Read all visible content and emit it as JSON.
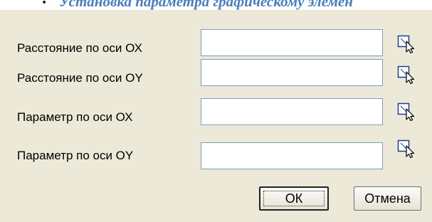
{
  "header": {
    "bullet": "•",
    "text": "Установка параметра графическому элемен"
  },
  "dialog": {
    "rows": [
      {
        "label": "Расстояние по оси ОХ",
        "value": ""
      },
      {
        "label": "Расстояние по оси ОY",
        "value": ""
      },
      {
        "label": "Параметр по оси ОХ",
        "value": ""
      },
      {
        "label": "Параметр по оси ОY",
        "value": ""
      }
    ],
    "ok_label": "ОК",
    "cancel_label": "Отмена"
  },
  "colors": {
    "dialog_background": "#ece9d8",
    "header_text": "#4a7ebb",
    "field_border": "#7f9db9"
  },
  "icons": [
    "pick-cursor-icon"
  ]
}
